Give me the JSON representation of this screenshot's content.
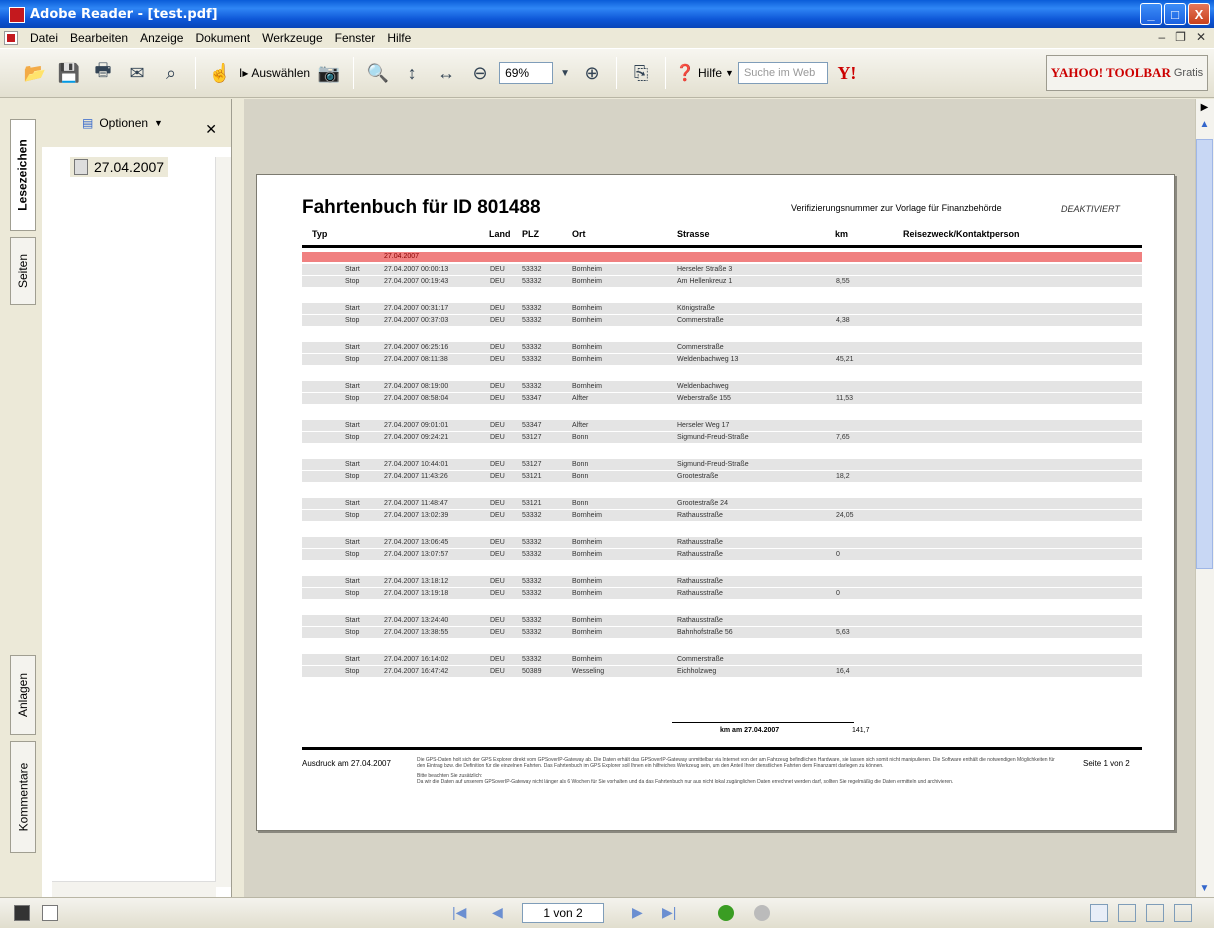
{
  "window": {
    "title": "Adobe Reader - [test.pdf]",
    "min_label": "_",
    "max_label": "□",
    "close_label": "X"
  },
  "menu": [
    "Datei",
    "Bearbeiten",
    "Anzeige",
    "Dokument",
    "Werkzeuge",
    "Fenster",
    "Hilfe"
  ],
  "toolbar": {
    "select_label": "Auswählen",
    "zoom_value": "69%",
    "help_label": "Hilfe",
    "search_placeholder": "Suche im Web",
    "yahoo_brand": "YAHOO! TOOLBAR",
    "yahoo_sub": "Gratis"
  },
  "side_tabs": [
    "Lesezeichen",
    "Seiten",
    "Anlagen",
    "Kommentare"
  ],
  "bookmarks": {
    "options_label": "Optionen",
    "items": [
      "27.04.2007"
    ]
  },
  "document": {
    "title": "Fahrtenbuch für ID 801488",
    "verification": "Verifizierungsnummer zur Vorlage für Finanzbehörde",
    "status": "DEAKTIVIERT",
    "columns": [
      "Typ",
      "Land",
      "PLZ",
      "Ort",
      "Strasse",
      "km",
      "Reisezweck/Kontaktperson"
    ],
    "date_header": "27.04.2007",
    "trips": [
      [
        [
          "Start",
          "27.04.2007 00:00:13",
          "DEU",
          "53332",
          "Bornheim",
          "Herseler Straße 3",
          ""
        ],
        [
          "Stop",
          "27.04.2007 00:19:43",
          "DEU",
          "53332",
          "Bornheim",
          "Am Hellenkreuz 1",
          "8,55"
        ]
      ],
      [
        [
          "Start",
          "27.04.2007 00:31:17",
          "DEU",
          "53332",
          "Bornheim",
          "Königstraße",
          ""
        ],
        [
          "Stop",
          "27.04.2007 00:37:03",
          "DEU",
          "53332",
          "Bornheim",
          "Commerstraße",
          "4,38"
        ]
      ],
      [
        [
          "Start",
          "27.04.2007 06:25:16",
          "DEU",
          "53332",
          "Bornheim",
          "Commerstraße",
          ""
        ],
        [
          "Stop",
          "27.04.2007 08:11:38",
          "DEU",
          "53332",
          "Bornheim",
          "Weldenbachweg 13",
          "45,21"
        ]
      ],
      [
        [
          "Start",
          "27.04.2007 08:19:00",
          "DEU",
          "53332",
          "Bornheim",
          "Weldenbachweg",
          ""
        ],
        [
          "Stop",
          "27.04.2007 08:58:04",
          "DEU",
          "53347",
          "Alfter",
          "Weberstraße 155",
          "11,53"
        ]
      ],
      [
        [
          "Start",
          "27.04.2007 09:01:01",
          "DEU",
          "53347",
          "Alfter",
          "Herseler Weg 17",
          ""
        ],
        [
          "Stop",
          "27.04.2007 09:24:21",
          "DEU",
          "53127",
          "Bonn",
          "Sigmund-Freud-Straße",
          "7,65"
        ]
      ],
      [
        [
          "Start",
          "27.04.2007 10:44:01",
          "DEU",
          "53127",
          "Bonn",
          "Sigmund-Freud-Straße",
          ""
        ],
        [
          "Stop",
          "27.04.2007 11:43:26",
          "DEU",
          "53121",
          "Bonn",
          "Grootestraße",
          "18,2"
        ]
      ],
      [
        [
          "Start",
          "27.04.2007 11:48:47",
          "DEU",
          "53121",
          "Bonn",
          "Grootestraße 24",
          ""
        ],
        [
          "Stop",
          "27.04.2007 13:02:39",
          "DEU",
          "53332",
          "Bornheim",
          "Rathausstraße",
          "24,05"
        ]
      ],
      [
        [
          "Start",
          "27.04.2007 13:06:45",
          "DEU",
          "53332",
          "Bornheim",
          "Rathausstraße",
          ""
        ],
        [
          "Stop",
          "27.04.2007 13:07:57",
          "DEU",
          "53332",
          "Bornheim",
          "Rathausstraße",
          "0"
        ]
      ],
      [
        [
          "Start",
          "27.04.2007 13:18:12",
          "DEU",
          "53332",
          "Bornheim",
          "Rathausstraße",
          ""
        ],
        [
          "Stop",
          "27.04.2007 13:19:18",
          "DEU",
          "53332",
          "Bornheim",
          "Rathausstraße",
          "0"
        ]
      ],
      [
        [
          "Start",
          "27.04.2007 13:24:40",
          "DEU",
          "53332",
          "Bornheim",
          "Rathausstraße",
          ""
        ],
        [
          "Stop",
          "27.04.2007 13:38:55",
          "DEU",
          "53332",
          "Bornheim",
          "Bahnhofstraße 56",
          "5,63"
        ]
      ],
      [
        [
          "Start",
          "27.04.2007 16:14:02",
          "DEU",
          "53332",
          "Bornheim",
          "Commerstraße",
          ""
        ],
        [
          "Stop",
          "27.04.2007 16:47:42",
          "DEU",
          "50389",
          "Wesseling",
          "Eichholzweg",
          "16,4"
        ]
      ]
    ],
    "sum_label": "km am 27.04.2007",
    "sum_value": "141,7",
    "footer_left": "Ausdruck am 27.04.2007",
    "footer_right": "Seite 1 von 2",
    "footer_text_1": "Die GPS-Daten holt sich der GPS Explorer direkt vom GPSoverIP-Gateway ab. Die Daten erhält das GPSoverIP-Gateway unmittelbar via Internet von der am Fahrzeug befindlichen Hardware, sie lassen sich somit nicht manipulieren. Die Software enthält die notwendigen Möglichkeiten für den Eintrag bzw. die Definition für die einzelnen Fahrten. Das Fahrtenbuch im GPS Explorer soll Ihnen ein hilfreiches Werkzeug sein, um den Anteil Ihrer dienstlichen Fahrten dem Finanzamt darlegen zu können.",
    "footer_text_2": "Bitte beachten Sie zusätzlich:",
    "footer_text_3": "Da wir die Daten auf unserem GPSoverIP-Gateway nicht länger als 6 Wochen für Sie vorhalten und da das Fahrtenbuch nur aus nicht lokal zugänglichen Daten errechnet werden darf, sollten Sie regelmäßig die Daten ermitteln und archivieren."
  },
  "statusbar": {
    "page_indicator": "1 von 2"
  }
}
